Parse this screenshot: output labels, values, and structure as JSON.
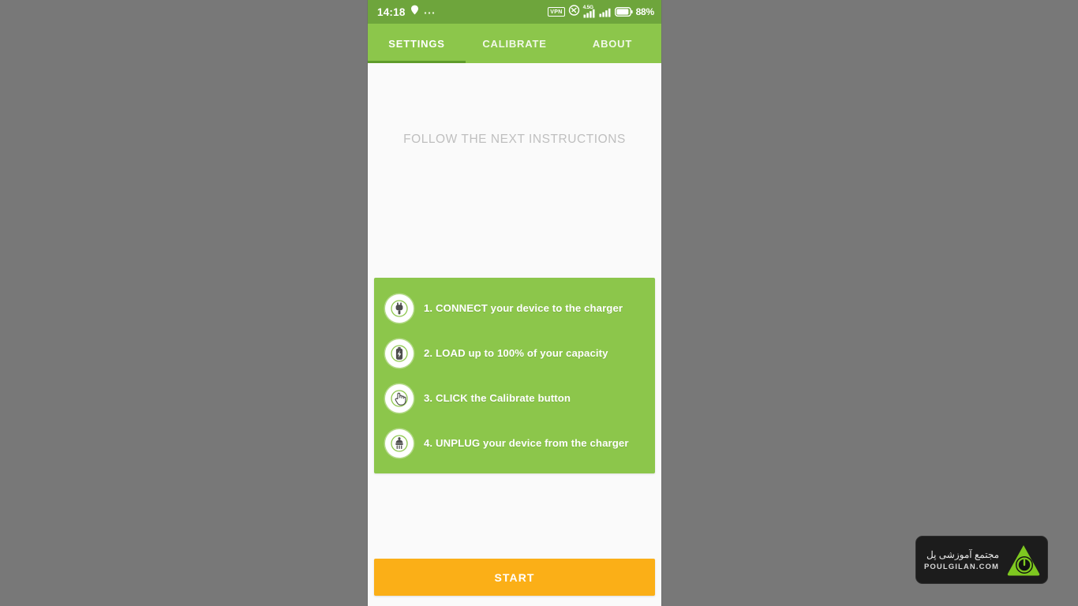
{
  "status_bar": {
    "time": "14:18",
    "location_icon": "location-pin-icon",
    "overflow_icon": "more-dots-icon",
    "vpn_label": "VPN",
    "link_icon": "link-icon",
    "network_type": "4.5G",
    "signal_icon_1": "signal-bars-icon",
    "signal_icon_2": "signal-bars-icon",
    "battery_icon": "battery-icon",
    "battery_percent": "88%",
    "background_color": "#6ea53c"
  },
  "tabs": [
    {
      "label": "SETTINGS",
      "active": true
    },
    {
      "label": "CALIBRATE",
      "active": false
    },
    {
      "label": "ABOUT",
      "active": false
    }
  ],
  "tab_bar": {
    "background_color": "#8cc64b",
    "indicator_color": "#5f9c2b"
  },
  "main": {
    "headline": "FOLLOW THE NEXT INSTRUCTIONS",
    "headline_color": "#bfbfbf",
    "background_color": "#fafafa"
  },
  "instructions": {
    "card_color": "#8cc64b",
    "items": [
      {
        "icon": "power-plug-icon",
        "text": "1. CONNECT your device to the charger"
      },
      {
        "icon": "battery-charging-icon",
        "text": "2. LOAD up to 100% of your capacity"
      },
      {
        "icon": "click-hand-icon",
        "text": "3. CLICK the Calibrate button"
      },
      {
        "icon": "unplug-icon",
        "text": "4. UNPLUG your device from the charger"
      }
    ]
  },
  "start_button": {
    "label": "START",
    "color": "#fbaf17"
  },
  "watermark": {
    "persian_text": "مجتمع آموزشی پل",
    "site": "POULGILAN.COM",
    "logo_icon": "power-triangle-logo-icon",
    "logo_color": "#7ec820",
    "background_color": "#1c1c1c"
  }
}
